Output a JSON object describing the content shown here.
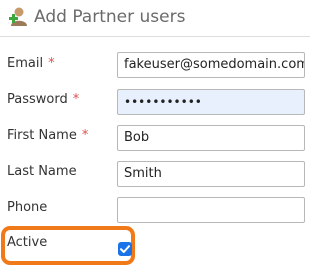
{
  "header": {
    "title": "Add Partner users",
    "icon": "add-user-icon"
  },
  "form": {
    "email": {
      "label": "Email",
      "required_mark": "*",
      "value": "fakeuser@somedomain.com"
    },
    "password": {
      "label": "Password",
      "required_mark": "*",
      "value": "•••••••••••"
    },
    "first_name": {
      "label": "First Name",
      "required_mark": "*",
      "value": "Bob"
    },
    "last_name": {
      "label": "Last Name",
      "value": "Smith"
    },
    "phone": {
      "label": "Phone",
      "value": ""
    },
    "active": {
      "label": "Active",
      "checked": true
    }
  },
  "colors": {
    "required": "#d9534f",
    "checkbox": "#1a73e8",
    "highlight": "#f07a1a",
    "autofill": "#e8f0fe"
  }
}
